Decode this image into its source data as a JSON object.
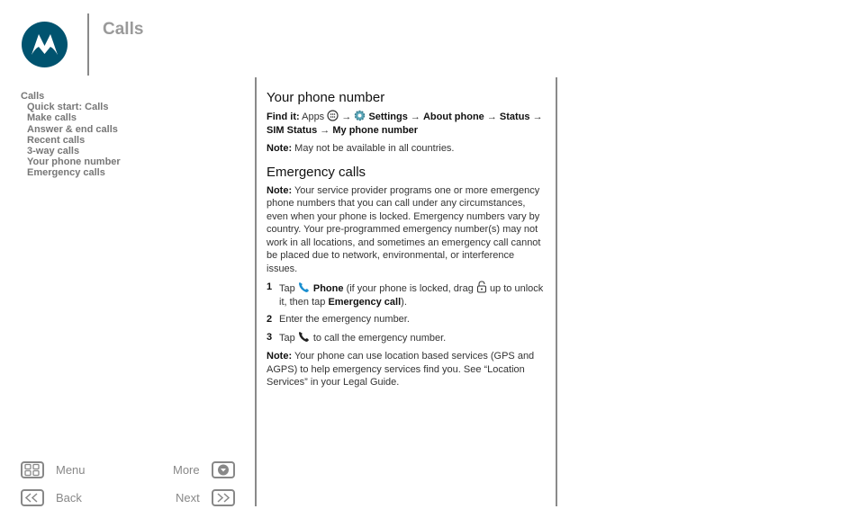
{
  "header": {
    "title": "Calls"
  },
  "toc": {
    "title": "Calls",
    "items": [
      "Quick start: Calls",
      "Make calls",
      "Answer & end calls",
      "Recent calls",
      "3-way calls",
      "Your phone number",
      "Emergency calls"
    ]
  },
  "sections": {
    "phone_number": {
      "heading": "Your phone number",
      "find_label": "Find it:",
      "apps": "Apps",
      "arrow": "→",
      "settings": "Settings",
      "about": "About phone",
      "status": "Status",
      "sim_status": "SIM Status",
      "my_number": "My phone number",
      "note_label": "Note:",
      "note_text": "May not be available in all countries."
    },
    "emergency": {
      "heading": "Emergency calls",
      "note_label": "Note:",
      "note_text": "Your service provider programs one or more emergency phone numbers that you can call under any circumstances, even when your phone is locked. Emergency numbers vary by country. Your pre-programmed emergency number(s) may not work in all locations, and sometimes an emergency call cannot be placed due to network, environmental, or interference issues.",
      "step1": {
        "num": "1",
        "tap": "Tap",
        "phone": "Phone",
        "text_a": "(if your phone is locked, drag",
        "text_b": "up to unlock it, then tap",
        "emergency_call": "Emergency call",
        "text_c": ")."
      },
      "step2": {
        "num": "2",
        "text": "Enter the emergency number."
      },
      "step3": {
        "num": "3",
        "tap": "Tap",
        "text": "to call the emergency number."
      },
      "note2_label": "Note:",
      "note2_text": "Your phone can use location based services (GPS and AGPS) to help emergency services find you. See “Location Services” in your Legal Guide."
    }
  },
  "nav": {
    "menu": "Menu",
    "more": "More",
    "back": "Back",
    "next": "Next"
  },
  "colors": {
    "brand": "#00536f",
    "phone_icon": "#1b8fd0"
  }
}
